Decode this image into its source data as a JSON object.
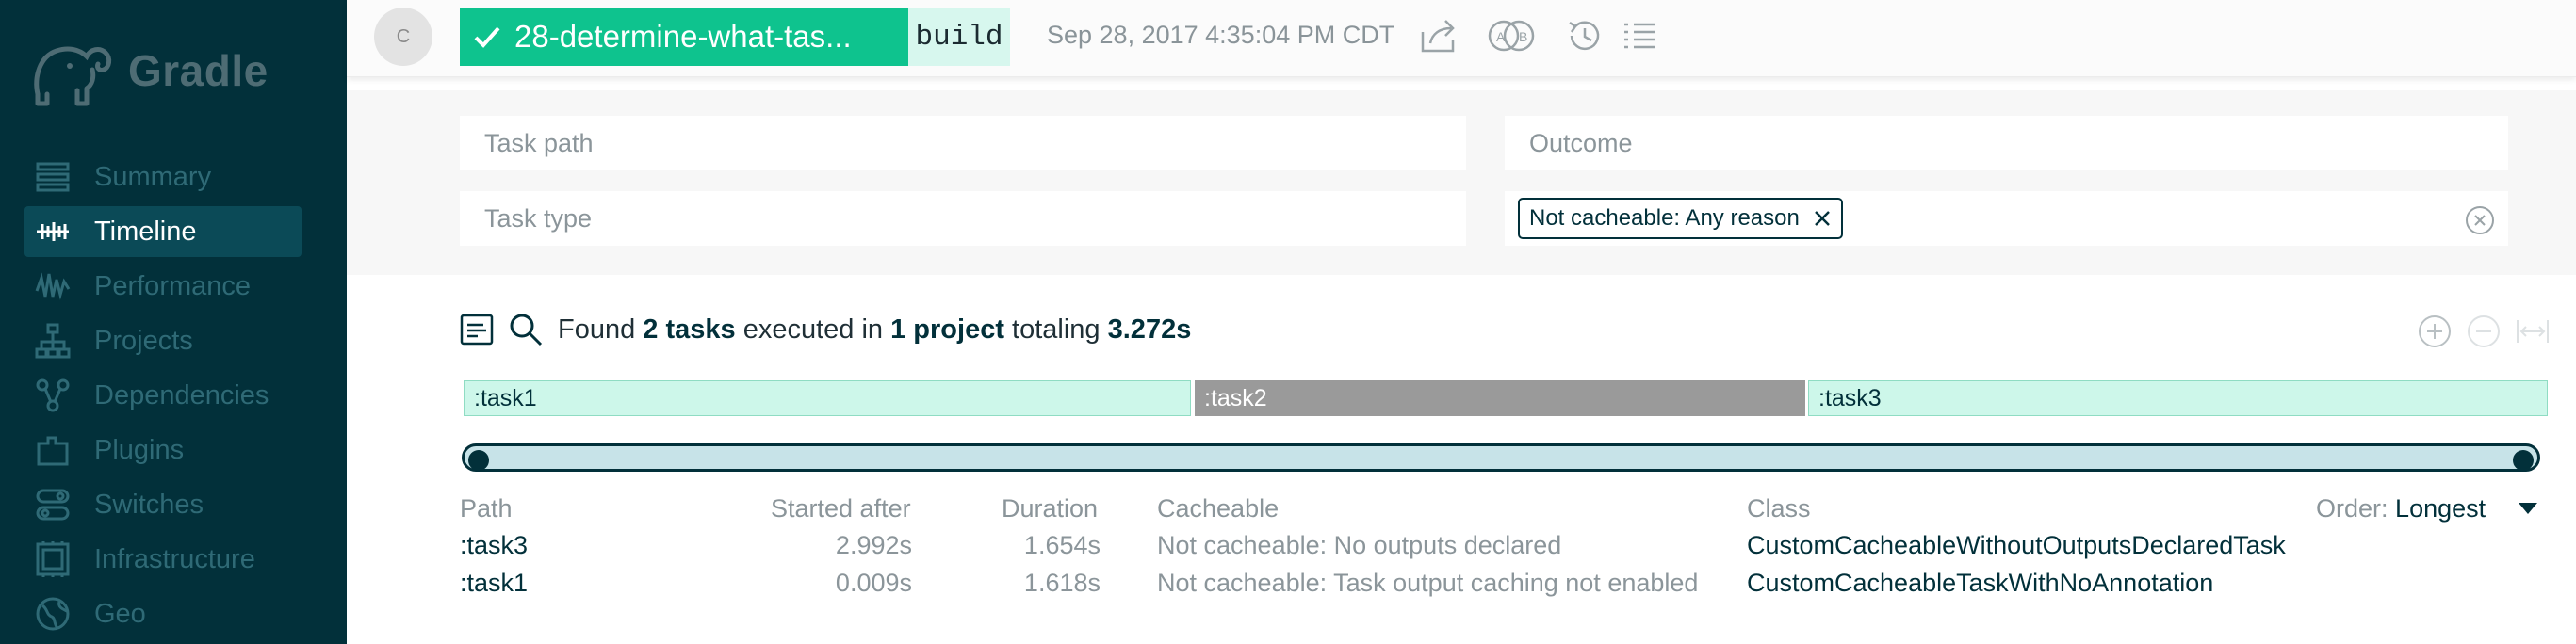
{
  "sidebar": {
    "logo_text": "Gradle",
    "items": [
      {
        "label": "Summary",
        "icon": "summary-icon",
        "active": false
      },
      {
        "label": "Timeline",
        "icon": "timeline-icon",
        "active": true
      },
      {
        "label": "Performance",
        "icon": "performance-icon",
        "active": false
      },
      {
        "label": "Projects",
        "icon": "projects-icon",
        "active": false
      },
      {
        "label": "Dependencies",
        "icon": "dependencies-icon",
        "active": false
      },
      {
        "label": "Plugins",
        "icon": "plugins-icon",
        "active": false
      },
      {
        "label": "Switches",
        "icon": "switches-icon",
        "active": false
      },
      {
        "label": "Infrastructure",
        "icon": "infrastructure-icon",
        "active": false
      },
      {
        "label": "Geo",
        "icon": "geo-icon",
        "active": false
      }
    ]
  },
  "header": {
    "avatar_initial": "C",
    "branch": "28-determine-what-tas...",
    "task": "build",
    "timestamp": "Sep 28, 2017 4:35:04 PM CDT"
  },
  "filters": {
    "task_path_placeholder": "Task path",
    "outcome_placeholder": "Outcome",
    "task_type_placeholder": "Task type",
    "chip_label": "Not cacheable: Any reason"
  },
  "summary": {
    "found": "Found",
    "tasks": "2 tasks",
    "executed_in": "executed in",
    "project": "1 project",
    "totaling": "totaling",
    "total": "3.272s"
  },
  "timeline": {
    "bars": [
      {
        "label": ":task1",
        "style": "cacheable"
      },
      {
        "label": ":task2",
        "style": "grey"
      },
      {
        "label": ":task3",
        "style": "cacheable"
      }
    ]
  },
  "table": {
    "headers": {
      "path": "Path",
      "started": "Started after",
      "duration": "Duration",
      "cacheable": "Cacheable",
      "class": "Class"
    },
    "order_label": "Order:",
    "order_value": "Longest",
    "rows": [
      {
        "path": ":task3",
        "started": "2.992s",
        "duration": "1.654s",
        "cacheable": "Not cacheable: No outputs declared",
        "class": "CustomCacheableWithoutOutputsDeclaredTask"
      },
      {
        "path": ":task1",
        "started": "0.009s",
        "duration": "1.618s",
        "cacheable": "Not cacheable: Task output caching not enabled",
        "class": "CustomCacheableTaskWithNoAnnotation"
      }
    ]
  },
  "colors": {
    "sidebar_bg": "#02303a",
    "accent_green": "#0ec38e",
    "cacheable_fill": "#cdf7ea",
    "grey_bar": "#9a9a9a"
  }
}
